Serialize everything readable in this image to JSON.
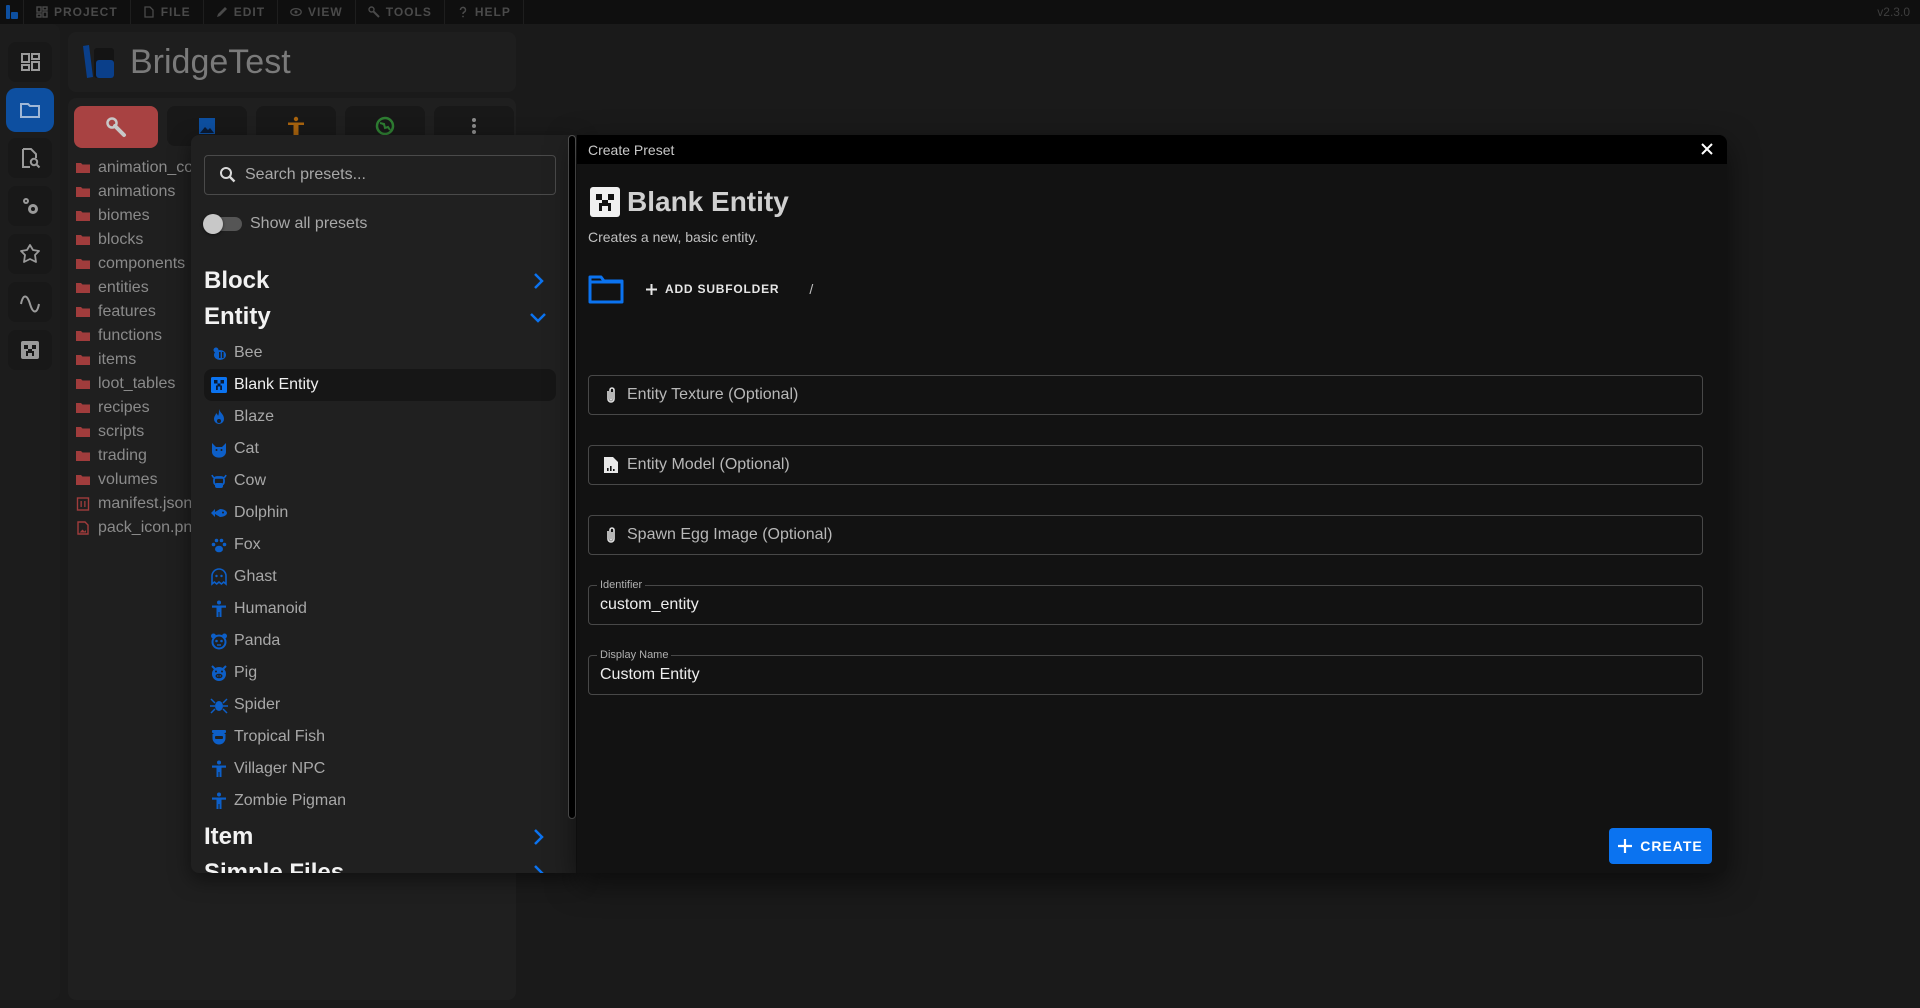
{
  "menubar": {
    "items": [
      {
        "label": "PROJECT",
        "icon": "dashboard-icon"
      },
      {
        "label": "FILE",
        "icon": "file-icon"
      },
      {
        "label": "EDIT",
        "icon": "pencil-icon"
      },
      {
        "label": "VIEW",
        "icon": "eye-icon"
      },
      {
        "label": "TOOLS",
        "icon": "wrench-icon"
      },
      {
        "label": "HELP",
        "icon": "question-icon"
      }
    ],
    "version": "v2.3.0"
  },
  "sidebar": {
    "items": [
      {
        "name": "dashboard",
        "icon": "dashboard-icon",
        "active": false
      },
      {
        "name": "explorer",
        "icon": "folder-icon",
        "active": true
      },
      {
        "name": "file-search",
        "icon": "file-search-icon",
        "active": false
      },
      {
        "name": "settings",
        "icon": "gears-icon",
        "active": false
      },
      {
        "name": "extensions",
        "icon": "puzzle-icon",
        "active": false
      },
      {
        "name": "animations",
        "icon": "wave-icon",
        "active": false
      },
      {
        "name": "minecraft",
        "icon": "creeper-icon",
        "active": false
      }
    ]
  },
  "project": {
    "title": "BridgeTest"
  },
  "explorer": {
    "tabs": [
      {
        "name": "behavior-pack",
        "icon": "wrench-icon",
        "active": true
      },
      {
        "name": "resource-pack",
        "icon": "image-icon",
        "active": false
      },
      {
        "name": "skin-pack",
        "icon": "humanoid-icon",
        "active": false
      },
      {
        "name": "world",
        "icon": "globe-icon",
        "active": false
      },
      {
        "name": "more",
        "icon": "more-vertical-icon",
        "active": false
      }
    ],
    "files": [
      {
        "name": "animation_controllers",
        "type": "folder"
      },
      {
        "name": "animations",
        "type": "folder"
      },
      {
        "name": "biomes",
        "type": "folder"
      },
      {
        "name": "blocks",
        "type": "folder"
      },
      {
        "name": "components",
        "type": "folder"
      },
      {
        "name": "entities",
        "type": "folder"
      },
      {
        "name": "features",
        "type": "folder"
      },
      {
        "name": "functions",
        "type": "folder"
      },
      {
        "name": "items",
        "type": "folder"
      },
      {
        "name": "loot_tables",
        "type": "folder"
      },
      {
        "name": "recipes",
        "type": "folder"
      },
      {
        "name": "scripts",
        "type": "folder"
      },
      {
        "name": "trading",
        "type": "folder"
      },
      {
        "name": "volumes",
        "type": "folder"
      },
      {
        "name": "manifest.json",
        "type": "json"
      },
      {
        "name": "pack_icon.png",
        "type": "image"
      }
    ]
  },
  "presets": {
    "search_placeholder": "Search presets...",
    "search_value": "",
    "show_all_label": "Show all presets",
    "show_all": false,
    "categories": [
      {
        "label": "Block",
        "expanded": false
      },
      {
        "label": "Entity",
        "expanded": true
      },
      {
        "label": "Item",
        "expanded": false
      },
      {
        "label": "Simple Files",
        "expanded": false
      }
    ],
    "entity_items": [
      {
        "label": "Bee",
        "icon": "bee-icon"
      },
      {
        "label": "Blank Entity",
        "icon": "creeper-icon",
        "selected": true
      },
      {
        "label": "Blaze",
        "icon": "fire-icon"
      },
      {
        "label": "Cat",
        "icon": "cat-icon"
      },
      {
        "label": "Cow",
        "icon": "cow-icon"
      },
      {
        "label": "Dolphin",
        "icon": "fish-icon"
      },
      {
        "label": "Fox",
        "icon": "paw-icon"
      },
      {
        "label": "Ghast",
        "icon": "ghost-icon"
      },
      {
        "label": "Humanoid",
        "icon": "humanoid-icon"
      },
      {
        "label": "Panda",
        "icon": "panda-icon"
      },
      {
        "label": "Pig",
        "icon": "pig-icon"
      },
      {
        "label": "Spider",
        "icon": "spider-icon"
      },
      {
        "label": "Tropical Fish",
        "icon": "fishbowl-icon"
      },
      {
        "label": "Villager NPC",
        "icon": "humanoid-icon"
      },
      {
        "label": "Zombie Pigman",
        "icon": "humanoid-icon"
      }
    ]
  },
  "dialog": {
    "title": "Create Preset",
    "preset_name": "Blank Entity",
    "preset_description": "Creates a new, basic entity.",
    "add_subfolder_label": "ADD SUBFOLDER",
    "path": "/",
    "file_inputs": [
      {
        "label": "Entity Texture (Optional)",
        "icon": "paperclip-icon"
      },
      {
        "label": "Entity Model (Optional)",
        "icon": "file-chart-icon"
      },
      {
        "label": "Spawn Egg Image (Optional)",
        "icon": "paperclip-icon"
      }
    ],
    "fields": [
      {
        "label": "Identifier",
        "value": "custom_entity"
      },
      {
        "label": "Display Name",
        "value": "Custom Entity"
      }
    ],
    "create_label": "CREATE"
  },
  "colors": {
    "accent": "#0b73f0",
    "active_tab": "#a84242",
    "sidebar_active": "#0d4fa0",
    "folder_icon": "#a03c3c",
    "preset_icon": "#0d5fc8"
  }
}
